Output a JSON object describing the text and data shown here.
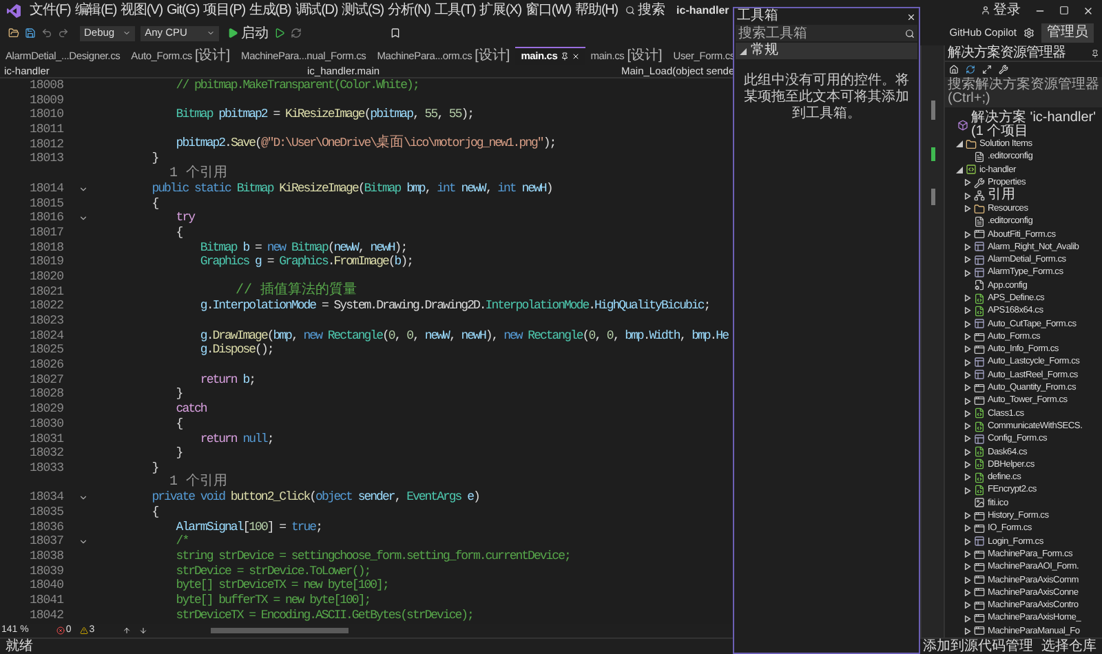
{
  "menu": {
    "items": [
      "文件(F)",
      "编辑(E)",
      "视图(V)",
      "Git(G)",
      "项目(P)",
      "生成(B)",
      "调试(D)",
      "测试(S)",
      "分析(N)",
      "工具(T)",
      "扩展(X)",
      "窗口(W)",
      "帮助(H)"
    ],
    "search": "搜索",
    "title": "ic-handler",
    "sign_in": "登录"
  },
  "toolbar": {
    "configuration": "Debug",
    "platform": "Any CPU",
    "start": "启动",
    "copilot": "GitHub Copilot",
    "admin": "管理员"
  },
  "tabs": [
    {
      "label": "AlarmDetial_...Designer.cs",
      "selected": false
    },
    {
      "label": "Auto_Form.cs",
      "suffix": "[设计]",
      "selected": false
    },
    {
      "label": "MachinePara...nual_Form.cs",
      "selected": false
    },
    {
      "label": "MachinePara...orm.cs",
      "suffix": "[设计]",
      "selected": false
    },
    {
      "label": "main.cs",
      "selected": true
    },
    {
      "label": "main.cs",
      "suffix": "[设计]",
      "selected": false
    },
    {
      "label": "User_Form.cs",
      "selected": false
    }
  ],
  "nav": {
    "project": "ic-handler",
    "class": "ic_handler.main",
    "member": "Main_Load(object sende"
  },
  "editor": {
    "lines": [
      {
        "kind": "code",
        "n": "18008",
        "fold": false,
        "code": [
          {
            "kind": "cm",
            "text": "            // pbitmap.MakeTransparent(Color.White);"
          }
        ]
      },
      {
        "kind": "code",
        "n": "18009",
        "fold": false
      },
      {
        "kind": "code",
        "n": "18010",
        "fold": false,
        "code": [
          {
            "kind": "type",
            "text": "            Bitmap "
          },
          {
            "kind": "var",
            "text": "pbitmap2"
          },
          {
            "kind": "p",
            "text": " = "
          },
          {
            "kind": "fn",
            "text": "KiResizeImage"
          },
          {
            "kind": "p",
            "text": "("
          },
          {
            "kind": "var",
            "text": "pbitmap"
          },
          {
            "kind": "p",
            "text": ", "
          },
          {
            "kind": "num",
            "text": "55"
          },
          {
            "kind": "p",
            "text": ", "
          },
          {
            "kind": "num",
            "text": "55"
          },
          {
            "kind": "p",
            "text": ");"
          }
        ]
      },
      {
        "kind": "code",
        "n": "18011",
        "fold": false
      },
      {
        "kind": "code",
        "n": "18012",
        "fold": false,
        "code": [
          {
            "kind": "var",
            "text": "            pbitmap2"
          },
          {
            "kind": "p",
            "text": "."
          },
          {
            "kind": "fn",
            "text": "Save"
          },
          {
            "kind": "p",
            "text": "("
          },
          {
            "kind": "str",
            "text": "@\"D:\\User\\OneDrive\\"
          },
          {
            "kind": "strcjk",
            "text": "桌面"
          },
          {
            "kind": "str",
            "text": "\\ico\\motorjog_new1.png\""
          },
          {
            "kind": "p",
            "text": ");"
          }
        ]
      },
      {
        "kind": "code",
        "n": "18013",
        "fold": false,
        "code": [
          {
            "kind": "p",
            "text": "        }"
          }
        ]
      },
      {
        "kind": "ref",
        "fold": false,
        "code": [
          {
            "kind": "ref",
            "text": "        1 个引用"
          }
        ]
      },
      {
        "kind": "code",
        "n": "18014",
        "fold": true,
        "code": [
          {
            "kind": "kw",
            "text": "        public static "
          },
          {
            "kind": "type",
            "text": "Bitmap "
          },
          {
            "kind": "fn",
            "text": "KiResizeImage"
          },
          {
            "kind": "p",
            "text": "("
          },
          {
            "kind": "type",
            "text": "Bitmap "
          },
          {
            "kind": "var",
            "text": "bmp"
          },
          {
            "kind": "p",
            "text": ", "
          },
          {
            "kind": "kw",
            "text": "int "
          },
          {
            "kind": "var",
            "text": "newW"
          },
          {
            "kind": "p",
            "text": ", "
          },
          {
            "kind": "kw",
            "text": "int "
          },
          {
            "kind": "var",
            "text": "newH"
          },
          {
            "kind": "p",
            "text": ")"
          }
        ]
      },
      {
        "kind": "code",
        "n": "18015",
        "fold": false,
        "code": [
          {
            "kind": "p",
            "text": "        {"
          }
        ]
      },
      {
        "kind": "code",
        "n": "18016",
        "fold": true,
        "code": [
          {
            "kind": "ctl",
            "text": "            try"
          }
        ]
      },
      {
        "kind": "code",
        "n": "18017",
        "fold": false,
        "code": [
          {
            "kind": "p",
            "text": "            {"
          }
        ]
      },
      {
        "kind": "code",
        "n": "18018",
        "fold": false,
        "code": [
          {
            "kind": "type",
            "text": "                Bitmap "
          },
          {
            "kind": "var",
            "text": "b"
          },
          {
            "kind": "p",
            "text": " = "
          },
          {
            "kind": "kw",
            "text": "new "
          },
          {
            "kind": "type",
            "text": "Bitmap"
          },
          {
            "kind": "p",
            "text": "("
          },
          {
            "kind": "var",
            "text": "newW"
          },
          {
            "kind": "p",
            "text": ", "
          },
          {
            "kind": "var",
            "text": "newH"
          },
          {
            "kind": "p",
            "text": ");"
          }
        ]
      },
      {
        "kind": "code",
        "n": "18019",
        "fold": false,
        "code": [
          {
            "kind": "type",
            "text": "                Graphics "
          },
          {
            "kind": "var",
            "text": "g"
          },
          {
            "kind": "p",
            "text": " = "
          },
          {
            "kind": "type",
            "text": "Graphics"
          },
          {
            "kind": "p",
            "text": "."
          },
          {
            "kind": "fn",
            "text": "FromImage"
          },
          {
            "kind": "p",
            "text": "("
          },
          {
            "kind": "var",
            "text": "b"
          },
          {
            "kind": "p",
            "text": ");"
          }
        ]
      },
      {
        "kind": "code",
        "n": "18020",
        "fold": false
      },
      {
        "kind": "code",
        "n": "18021",
        "fold": false,
        "code": [
          {
            "kind": "cmcjk",
            "text": "                // 插值算法的質量"
          }
        ]
      },
      {
        "kind": "code",
        "n": "18022",
        "fold": false,
        "code": [
          {
            "kind": "var",
            "text": "                g"
          },
          {
            "kind": "p",
            "text": "."
          },
          {
            "kind": "var",
            "text": "InterpolationMode"
          },
          {
            "kind": "p",
            "text": " = System.Drawing.Drawing2D."
          },
          {
            "kind": "type",
            "text": "InterpolationMode"
          },
          {
            "kind": "p",
            "text": "."
          },
          {
            "kind": "var",
            "text": "HighQualityBicubic"
          },
          {
            "kind": "p",
            "text": ";"
          }
        ]
      },
      {
        "kind": "code",
        "n": "18023",
        "fold": false
      },
      {
        "kind": "code",
        "n": "18024",
        "fold": false,
        "code": [
          {
            "kind": "var",
            "text": "                g"
          },
          {
            "kind": "p",
            "text": "."
          },
          {
            "kind": "fn",
            "text": "DrawImage"
          },
          {
            "kind": "p",
            "text": "("
          },
          {
            "kind": "var",
            "text": "bmp"
          },
          {
            "kind": "p",
            "text": ", "
          },
          {
            "kind": "kw",
            "text": "new "
          },
          {
            "kind": "type",
            "text": "Rectangle"
          },
          {
            "kind": "p",
            "text": "("
          },
          {
            "kind": "num",
            "text": "0"
          },
          {
            "kind": "p",
            "text": ", "
          },
          {
            "kind": "num",
            "text": "0"
          },
          {
            "kind": "p",
            "text": ", "
          },
          {
            "kind": "var",
            "text": "newW"
          },
          {
            "kind": "p",
            "text": ", "
          },
          {
            "kind": "var",
            "text": "newH"
          },
          {
            "kind": "p",
            "text": "), "
          },
          {
            "kind": "kw",
            "text": "new "
          },
          {
            "kind": "type",
            "text": "Rectangle"
          },
          {
            "kind": "p",
            "text": "("
          },
          {
            "kind": "num",
            "text": "0"
          },
          {
            "kind": "p",
            "text": ", "
          },
          {
            "kind": "num",
            "text": "0"
          },
          {
            "kind": "p",
            "text": ", "
          },
          {
            "kind": "var",
            "text": "bmp"
          },
          {
            "kind": "p",
            "text": "."
          },
          {
            "kind": "var",
            "text": "Width"
          },
          {
            "kind": "p",
            "text": ", "
          },
          {
            "kind": "var",
            "text": "bmp"
          },
          {
            "kind": "p",
            "text": "."
          },
          {
            "kind": "var",
            "text": "He"
          }
        ]
      },
      {
        "kind": "code",
        "n": "18025",
        "fold": false,
        "code": [
          {
            "kind": "var",
            "text": "                g"
          },
          {
            "kind": "p",
            "text": "."
          },
          {
            "kind": "fn",
            "text": "Dispose"
          },
          {
            "kind": "p",
            "text": "();"
          }
        ]
      },
      {
        "kind": "code",
        "n": "18026",
        "fold": false
      },
      {
        "kind": "code",
        "n": "18027",
        "fold": false,
        "code": [
          {
            "kind": "ctl",
            "text": "                return "
          },
          {
            "kind": "var",
            "text": "b"
          },
          {
            "kind": "p",
            "text": ";"
          }
        ]
      },
      {
        "kind": "code",
        "n": "18028",
        "fold": false,
        "code": [
          {
            "kind": "p",
            "text": "            }"
          }
        ]
      },
      {
        "kind": "code",
        "n": "18029",
        "fold": false,
        "code": [
          {
            "kind": "ctl",
            "text": "            catch"
          }
        ]
      },
      {
        "kind": "code",
        "n": "18030",
        "fold": false,
        "code": [
          {
            "kind": "p",
            "text": "            {"
          }
        ]
      },
      {
        "kind": "code",
        "n": "18031",
        "fold": false,
        "code": [
          {
            "kind": "ctl",
            "text": "                return "
          },
          {
            "kind": "kw",
            "text": "null"
          },
          {
            "kind": "p",
            "text": ";"
          }
        ]
      },
      {
        "kind": "code",
        "n": "18032",
        "fold": false,
        "code": [
          {
            "kind": "p",
            "text": "            }"
          }
        ]
      },
      {
        "kind": "code",
        "n": "18033",
        "fold": false,
        "code": [
          {
            "kind": "p",
            "text": "        }"
          }
        ]
      },
      {
        "kind": "ref",
        "fold": false,
        "code": [
          {
            "kind": "ref",
            "text": "        1 个引用"
          }
        ]
      },
      {
        "kind": "code",
        "n": "18034",
        "fold": true,
        "code": [
          {
            "kind": "kw",
            "text": "        private void "
          },
          {
            "kind": "fn",
            "text": "button2_Click"
          },
          {
            "kind": "p",
            "text": "("
          },
          {
            "kind": "kw",
            "text": "object "
          },
          {
            "kind": "var",
            "text": "sender"
          },
          {
            "kind": "p",
            "text": ", "
          },
          {
            "kind": "type",
            "text": "EventArgs "
          },
          {
            "kind": "var",
            "text": "e"
          },
          {
            "kind": "p",
            "text": ")"
          }
        ]
      },
      {
        "kind": "code",
        "n": "18035",
        "fold": false,
        "code": [
          {
            "kind": "p",
            "text": "        {"
          }
        ]
      },
      {
        "kind": "code",
        "n": "18036",
        "fold": false,
        "code": [
          {
            "kind": "var",
            "text": "            AlarmSignal"
          },
          {
            "kind": "p",
            "text": "["
          },
          {
            "kind": "num",
            "text": "100"
          },
          {
            "kind": "p",
            "text": "] = "
          },
          {
            "kind": "kw",
            "text": "true"
          },
          {
            "kind": "p",
            "text": ";"
          }
        ]
      },
      {
        "kind": "code",
        "n": "18037",
        "fold": true,
        "code": [
          {
            "kind": "cm",
            "text": "            /*"
          }
        ]
      },
      {
        "kind": "code",
        "n": "18038",
        "fold": false,
        "code": [
          {
            "kind": "cm",
            "text": "            string strDevice = settingchoose_form.setting_form.currentDevice;"
          }
        ]
      },
      {
        "kind": "code",
        "n": "18039",
        "fold": false,
        "code": [
          {
            "kind": "cm",
            "text": "            strDevice = strDevice.ToLower();"
          }
        ]
      },
      {
        "kind": "code",
        "n": "18040",
        "fold": false,
        "code": [
          {
            "kind": "cm",
            "text": "            byte[] strDeviceTX = new byte[100];"
          }
        ]
      },
      {
        "kind": "code",
        "n": "18041",
        "fold": false,
        "code": [
          {
            "kind": "cm",
            "text": "            byte[] bufferTX = new byte[100];"
          }
        ]
      },
      {
        "kind": "code",
        "n": "18042",
        "fold": false,
        "code": [
          {
            "kind": "cm",
            "text": "            strDeviceTX = Encoding.ASCII.GetBytes(strDevice);"
          }
        ]
      }
    ]
  },
  "status": {
    "zoom": "141 %",
    "errors": "0",
    "warnings": "3"
  },
  "toolbox": {
    "title": "工具箱",
    "search_placeholder": "搜索工具箱",
    "group": {
      "label": "常规",
      "expanded": true
    },
    "message": "此组中没有可用的控件。将某项拖至此文本可将其添加到工具箱。"
  },
  "solution_explorer": {
    "title": "解决方案资源管理器",
    "search_placeholder": "搜索解决方案资源管理器(Ctrl+;)",
    "tree": [
      {
        "label": "解决方案 'ic-handler' (1 个项目",
        "kind": "solution",
        "expandable": false,
        "children": [
          {
            "label": "Solution Items",
            "kind": "folder",
            "expandable": true,
            "expanded": true,
            "children": [
              {
                "label": ".editorconfig",
                "kind": "file",
                "expandable": false
              }
            ]
          },
          {
            "label": "ic-handler",
            "kind": "project",
            "expandable": true,
            "expanded": true,
            "children": [
              {
                "label": "Properties",
                "kind": "wrench",
                "expandable": true,
                "expanded": false
              },
              {
                "label": "引用",
                "kind": "references",
                "expandable": true,
                "expanded": false
              },
              {
                "label": "Resources",
                "kind": "folder",
                "expandable": true,
                "expanded": false
              },
              {
                "label": ".editorconfig",
                "kind": "file",
                "expandable": false
              },
              {
                "label": "AboutFiti_Form.cs",
                "kind": "form",
                "expandable": true,
                "expanded": false
              },
              {
                "label": "Alarm_Right_Not_Avalib",
                "kind": "designer",
                "expandable": true,
                "expanded": false
              },
              {
                "label": "AlarmDetial_Form.cs",
                "kind": "designer",
                "expandable": true,
                "expanded": false
              },
              {
                "label": "AlarmType_Form.cs",
                "kind": "designer",
                "expandable": true,
                "expanded": false
              },
              {
                "label": "App.config",
                "kind": "config",
                "expandable": false
              },
              {
                "label": "APS_Define.cs",
                "kind": "cs",
                "expandable": true,
                "expanded": false
              },
              {
                "label": "APS168x64.cs",
                "kind": "cs",
                "expandable": true,
                "expanded": false
              },
              {
                "label": "Auto_CutTape_Form.cs",
                "kind": "designer",
                "expandable": true,
                "expanded": false
              },
              {
                "label": "Auto_Form.cs",
                "kind": "form",
                "expandable": true,
                "expanded": false
              },
              {
                "label": "Auto_Info_Form.cs",
                "kind": "form",
                "expandable": true,
                "expanded": false
              },
              {
                "label": "Auto_Lastcycle_Form.cs",
                "kind": "designer",
                "expandable": true,
                "expanded": false
              },
              {
                "label": "Auto_LastReel_Form.cs",
                "kind": "designer",
                "expandable": true,
                "expanded": false
              },
              {
                "label": "Auto_Quantity_From.cs",
                "kind": "form",
                "expandable": true,
                "expanded": false
              },
              {
                "label": "Auto_Tower_Form.cs",
                "kind": "form",
                "expandable": true,
                "expanded": false
              },
              {
                "label": "Class1.cs",
                "kind": "cs",
                "expandable": true,
                "expanded": false
              },
              {
                "label": "CommunicateWithSECS.",
                "kind": "cs",
                "expandable": true,
                "expanded": false
              },
              {
                "label": "Config_Form.cs",
                "kind": "designer",
                "expandable": true,
                "expanded": false
              },
              {
                "label": "Dask64.cs",
                "kind": "cs",
                "expandable": true,
                "expanded": false
              },
              {
                "label": "DBHelper.cs",
                "kind": "cs",
                "expandable": true,
                "expanded": false
              },
              {
                "label": "define.cs",
                "kind": "cs",
                "expandable": true,
                "expanded": false
              },
              {
                "label": "FEncrypt2.cs",
                "kind": "cs",
                "expandable": true,
                "expanded": false
              },
              {
                "label": "fiti.ico",
                "kind": "image",
                "expandable": false
              },
              {
                "label": "History_Form.cs",
                "kind": "form",
                "expandable": true,
                "expanded": false
              },
              {
                "label": "IO_Form.cs",
                "kind": "form",
                "expandable": true,
                "expanded": false
              },
              {
                "label": "Login_Form.cs",
                "kind": "designer",
                "expandable": true,
                "expanded": false
              },
              {
                "label": "MachinePara_Form.cs",
                "kind": "form",
                "expandable": true,
                "expanded": false
              },
              {
                "label": "MachineParaAOI_Form.",
                "kind": "form",
                "expandable": true,
                "expanded": false
              },
              {
                "label": "MachineParaAxisComm",
                "kind": "form",
                "expandable": true,
                "expanded": false
              },
              {
                "label": "MachineParaAxisConne",
                "kind": "form",
                "expandable": true,
                "expanded": false
              },
              {
                "label": "MachineParaAxisContro",
                "kind": "form",
                "expandable": true,
                "expanded": false
              },
              {
                "label": "MachineParaAxisHome_",
                "kind": "form",
                "expandable": true,
                "expanded": false
              },
              {
                "label": "MachineParaManual_Fo",
                "kind": "form",
                "expandable": true,
                "expanded": false
              }
            ]
          }
        ]
      }
    ]
  },
  "status_bar": {
    "left": "就绪",
    "source_control": "添加到源代码管理",
    "repository": "选择仓库"
  }
}
